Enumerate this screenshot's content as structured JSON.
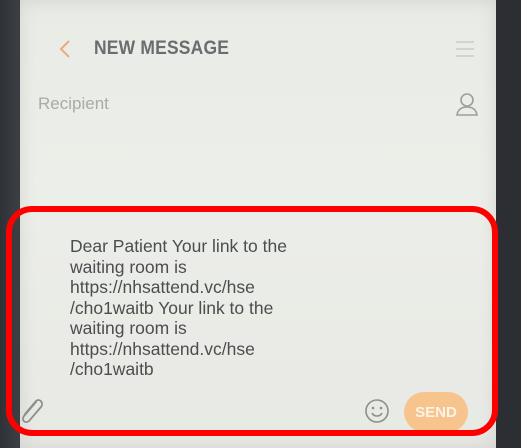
{
  "header": {
    "title": "NEW MESSAGE"
  },
  "recipient": {
    "placeholder": "Recipient"
  },
  "compose": {
    "message": "Dear Patient Your link to the\nwaiting room is\nhttps://nhsattend.vc/hse\n/cho1waitb Your link to the\nwaiting room is\nhttps://nhsattend.vc/hse\n/cho1waitb",
    "send_label": "SEND"
  },
  "colors": {
    "accent": "#f7c48d",
    "highlight": "#ff0000"
  },
  "icons": [
    "back-chevron-icon",
    "menu-icon",
    "contact-icon",
    "paperclip-icon",
    "emoji-icon"
  ]
}
